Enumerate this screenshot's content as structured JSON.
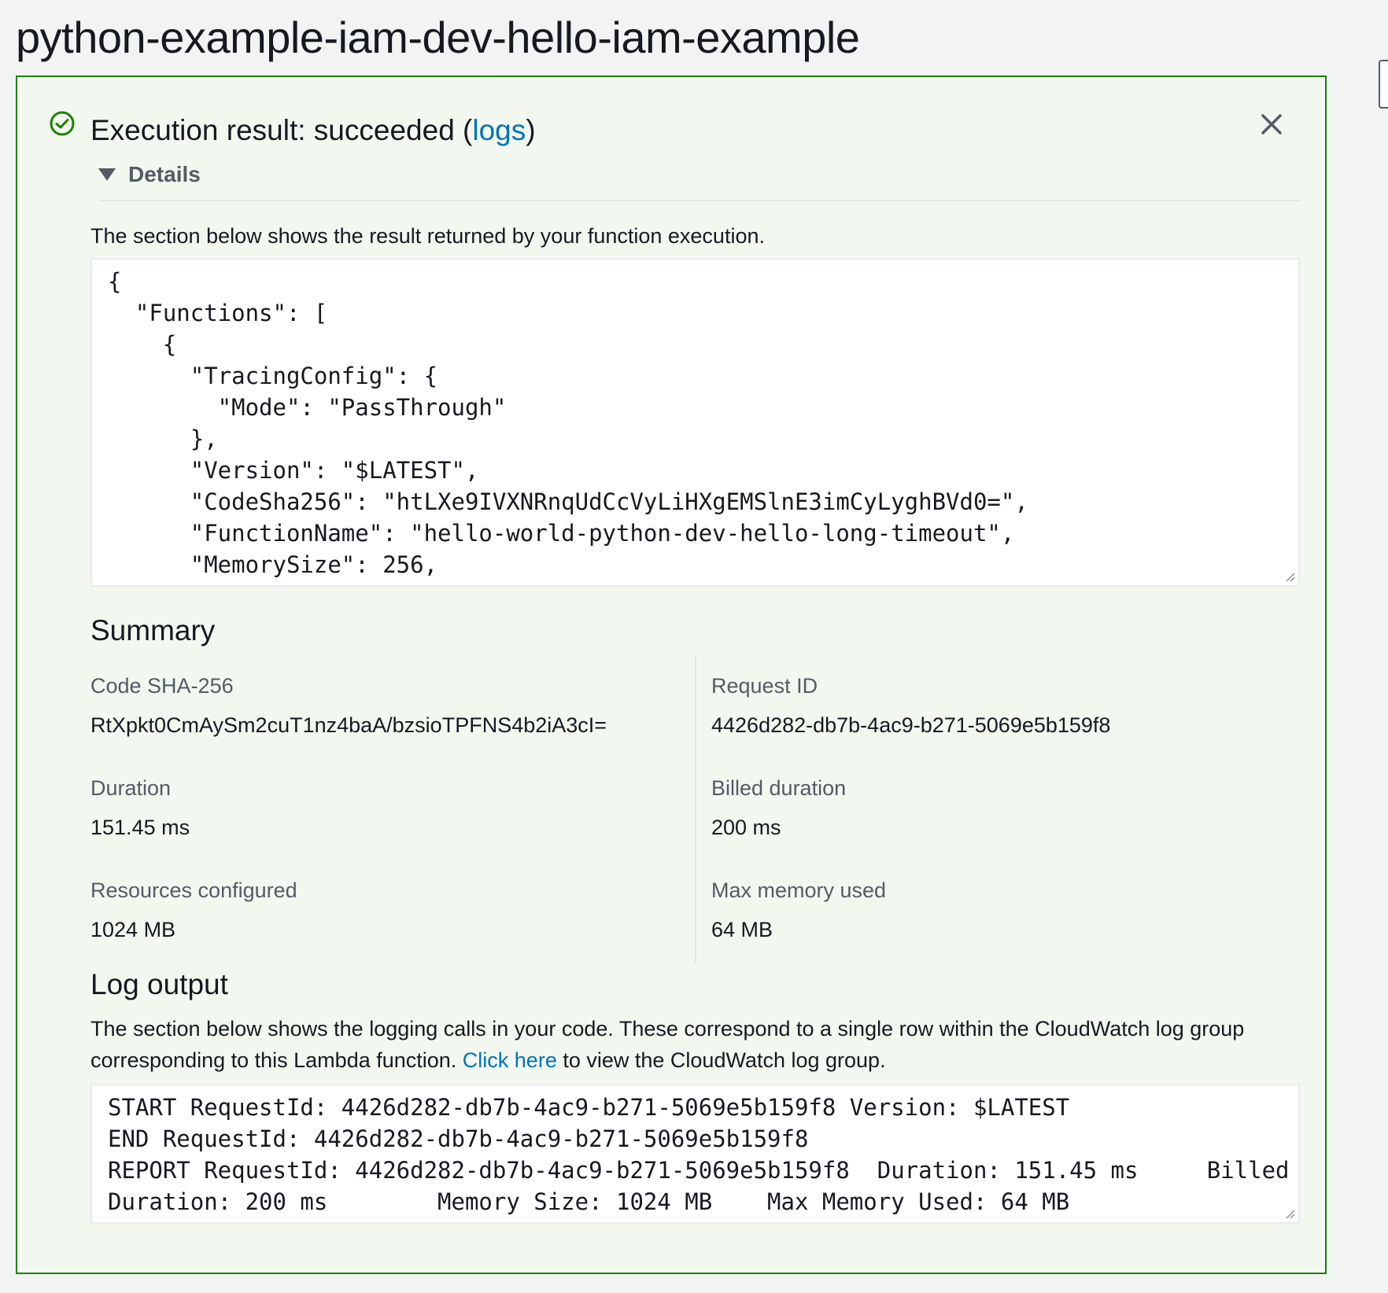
{
  "page_title": "python-example-iam-dev-hello-iam-example",
  "result": {
    "heading_prefix": "Execution result: succeeded (",
    "logs_link": "logs",
    "heading_suffix": ")",
    "details_label": "Details",
    "status_color": "#1d8102"
  },
  "function_result": {
    "description": "The section below shows the result returned by your function execution.",
    "lines": [
      "{",
      "  \"Functions\": [",
      "    {",
      "      \"TracingConfig\": {",
      "        \"Mode\": \"PassThrough\"",
      "      },",
      "      \"Version\": \"$LATEST\",",
      "      \"CodeSha256\": \"htLXe9IVXNRnqUdCcVyLiHXgEMSlnE3imCyLyghBVd0=\",",
      "      \"FunctionName\": \"hello-world-python-dev-hello-long-timeout\",",
      "      \"MemorySize\": 256,"
    ]
  },
  "summary": {
    "title": "Summary",
    "items": [
      {
        "label": "Code SHA-256",
        "value": "RtXpkt0CmAySm2cuT1nz4baA/bzsioTPFNS4b2iA3cI="
      },
      {
        "label": "Request ID",
        "value": "4426d282-db7b-4ac9-b271-5069e5b159f8"
      },
      {
        "label": "Duration",
        "value": "151.45 ms"
      },
      {
        "label": "Billed duration",
        "value": "200 ms"
      },
      {
        "label": "Resources configured",
        "value": "1024 MB"
      },
      {
        "label": "Max memory used",
        "value": "64 MB"
      }
    ]
  },
  "log_output": {
    "title": "Log output",
    "description_before": "The section below shows the logging calls in your code. These correspond to a single row within the CloudWatch log group corresponding to this Lambda function. ",
    "link_text": "Click here",
    "description_after": " to view the CloudWatch log group.",
    "lines": [
      "START RequestId: 4426d282-db7b-4ac9-b271-5069e5b159f8 Version: $LATEST",
      "END RequestId: 4426d282-db7b-4ac9-b271-5069e5b159f8",
      "REPORT RequestId: 4426d282-db7b-4ac9-b271-5069e5b159f8  Duration: 151.45 ms     Billed",
      "Duration: 200 ms        Memory Size: 1024 MB    Max Memory Used: 64 MB"
    ]
  },
  "icons": {
    "success": "check-circle-icon",
    "close": "close-icon",
    "details": "caret-down-icon"
  }
}
